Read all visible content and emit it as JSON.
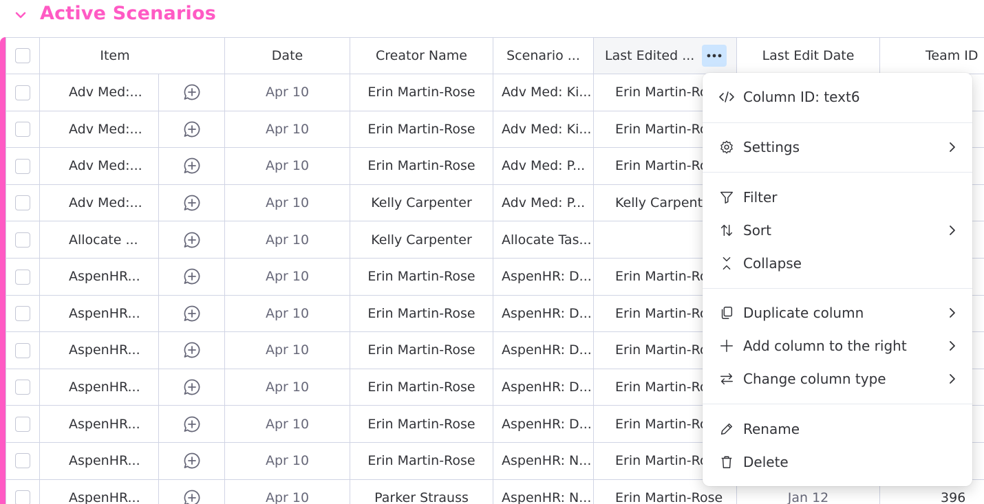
{
  "group": {
    "title": "Active Scenarios",
    "color": "#ff5ac4"
  },
  "columns": {
    "item": "Item",
    "date": "Date",
    "creator": "Creator Name",
    "scenario": "Scenario ...",
    "last_edited": "Last Edited ...",
    "last_edit_date": "Last Edit Date",
    "team_id": "Team ID"
  },
  "rows": [
    {
      "item": "Adv Med:...",
      "date": "Apr 10",
      "creator": "Erin Martin-Rose",
      "scenario": "Adv Med: Ki...",
      "last_edited": "Erin Martin-Ros"
    },
    {
      "item": "Adv Med:...",
      "date": "Apr 10",
      "creator": "Erin Martin-Rose",
      "scenario": "Adv Med: Ki...",
      "last_edited": "Erin Martin-Ros"
    },
    {
      "item": "Adv Med:...",
      "date": "Apr 10",
      "creator": "Erin Martin-Rose",
      "scenario": "Adv Med: P...",
      "last_edited": "Erin Martin-Ros"
    },
    {
      "item": "Adv Med:...",
      "date": "Apr 10",
      "creator": "Kelly Carpenter",
      "scenario": "Adv Med: P...",
      "last_edited": "Kelly Carpente"
    },
    {
      "item": "Allocate ...",
      "date": "Apr 10",
      "creator": "Kelly Carpenter",
      "scenario": "Allocate Tas...",
      "last_edited": ""
    },
    {
      "item": "AspenHR...",
      "date": "Apr 10",
      "creator": "Erin Martin-Rose",
      "scenario": "AspenHR: D...",
      "last_edited": "Erin Martin-Ros"
    },
    {
      "item": "AspenHR...",
      "date": "Apr 10",
      "creator": "Erin Martin-Rose",
      "scenario": "AspenHR: D...",
      "last_edited": "Erin Martin-Ros"
    },
    {
      "item": "AspenHR...",
      "date": "Apr 10",
      "creator": "Erin Martin-Rose",
      "scenario": "AspenHR: D...",
      "last_edited": "Erin Martin-Ros"
    },
    {
      "item": "AspenHR...",
      "date": "Apr 10",
      "creator": "Erin Martin-Rose",
      "scenario": "AspenHR: D...",
      "last_edited": "Erin Martin-Ros"
    },
    {
      "item": "AspenHR...",
      "date": "Apr 10",
      "creator": "Erin Martin-Rose",
      "scenario": "AspenHR: D...",
      "last_edited": "Erin Martin-Ros"
    },
    {
      "item": "AspenHR...",
      "date": "Apr 10",
      "creator": "Erin Martin-Rose",
      "scenario": "AspenHR: N...",
      "last_edited": "Erin Martin-Ros"
    },
    {
      "item": "AspenHR...",
      "date": "Apr 10",
      "creator": "Parker Strauss",
      "scenario": "AspenHR: N...",
      "last_edited": "Erin Martin-Rose",
      "last_edit_date": "Jan 12",
      "team_id": "396"
    }
  ],
  "menu": {
    "column_id": "Column ID: text6",
    "settings": "Settings",
    "filter": "Filter",
    "sort": "Sort",
    "collapse": "Collapse",
    "duplicate": "Duplicate column",
    "add_right": "Add column to the right",
    "change_type": "Change column type",
    "rename": "Rename",
    "delete": "Delete"
  },
  "icons": {
    "group_toggle": "chevron-down-icon",
    "more": "more-horizontal-icon",
    "updates": "add-update-icon",
    "column_id": "code-icon",
    "settings": "gear-icon",
    "filter": "filter-icon",
    "sort": "sort-icon",
    "collapse": "collapse-icon",
    "duplicate": "duplicate-icon",
    "add_right": "plus-icon",
    "change_type": "swap-icon",
    "rename": "pencil-icon",
    "delete": "trash-icon",
    "submenu": "chevron-right-icon"
  },
  "colors": {
    "accent": "#ff5ac4",
    "selected_button": "#cce5ff",
    "border": "#d0d4e4"
  }
}
